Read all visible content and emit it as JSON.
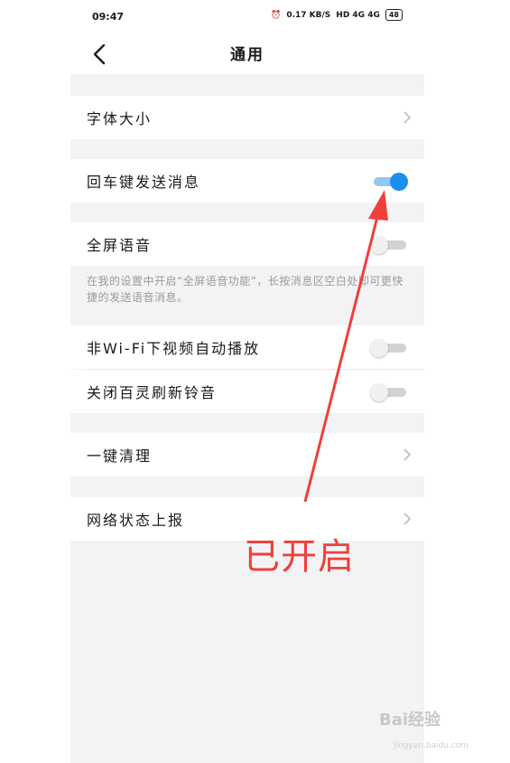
{
  "status_bar": {
    "time": "09:47",
    "net_speed": "0.17 KB/S",
    "indicators": "HD 4G 4G",
    "battery": "48"
  },
  "header": {
    "title": "通用"
  },
  "settings": {
    "font_size": {
      "label": "字体大小"
    },
    "enter_send": {
      "label": "回车键发送消息",
      "enabled": true
    },
    "fullscreen_voice": {
      "label": "全屏语音",
      "enabled": false,
      "hint": "在我的设置中开启“全屏语音功能”，长按消息区空白处即可更快捷的发送语音消息。"
    },
    "autoplay_video": {
      "label": "非Wi-Fi下视频自动播放",
      "enabled": false
    },
    "close_ringtone": {
      "label": "关闭百灵刷新铃音",
      "enabled": false
    },
    "one_click_clean": {
      "label": "一键清理"
    },
    "network_report": {
      "label": "网络状态上报"
    }
  },
  "annotation": {
    "label": "已开启",
    "color": "#f0403a"
  },
  "watermark": {
    "text": "Bai经验",
    "sub": "jingyan.baidu.com"
  },
  "colors": {
    "toggle_on": "#1a8fee",
    "background": "#f3f3f5"
  }
}
